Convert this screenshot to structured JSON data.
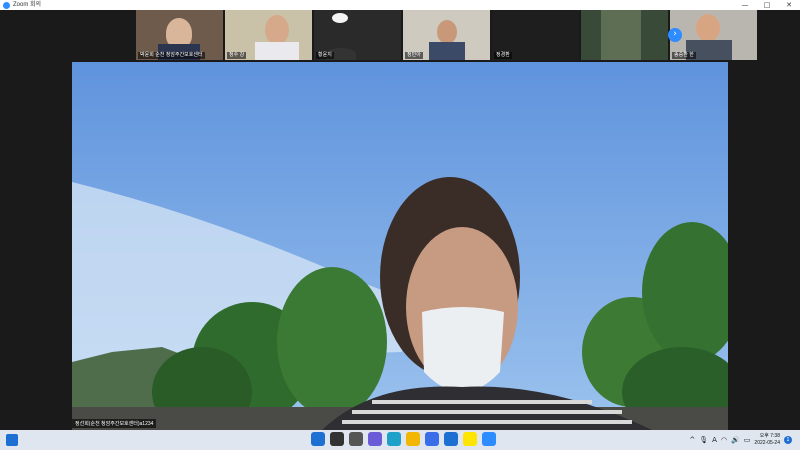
{
  "window": {
    "title": "Zoom 회의",
    "minimize_label": "—",
    "maximize_label": "□",
    "close_label": "✕"
  },
  "participants": [
    {
      "name": "박윤희 순천 청암주간보호센터"
    },
    {
      "name": "정수 강"
    },
    {
      "name": "황윤지"
    },
    {
      "name": "정민아"
    },
    {
      "name": "정경환"
    },
    {
      "name": ""
    },
    {
      "name": "송승환 한"
    }
  ],
  "strip": {
    "next_label": "›"
  },
  "main_video": {
    "name": "정선희(순천 청암주간보호센터)a1234"
  },
  "taskbar": {
    "icons": [
      "windows-start-icon",
      "search-icon",
      "task-view-icon",
      "chat-icon",
      "edge-icon",
      "file-explorer-icon",
      "store-icon",
      "mail-icon",
      "kakaotalk-icon",
      "zoom-icon"
    ],
    "colors": [
      "#1d6fd1",
      "#333333",
      "#555555",
      "#6b5bd6",
      "#1da1c9",
      "#f2b705",
      "#3a6ee8",
      "#1d6fd1",
      "#fee500",
      "#2d8cff"
    ],
    "tray": {
      "chevron": "^",
      "lang": "A",
      "time": "오후 7:38",
      "date": "2022-05-24",
      "notification_count": "1"
    }
  }
}
